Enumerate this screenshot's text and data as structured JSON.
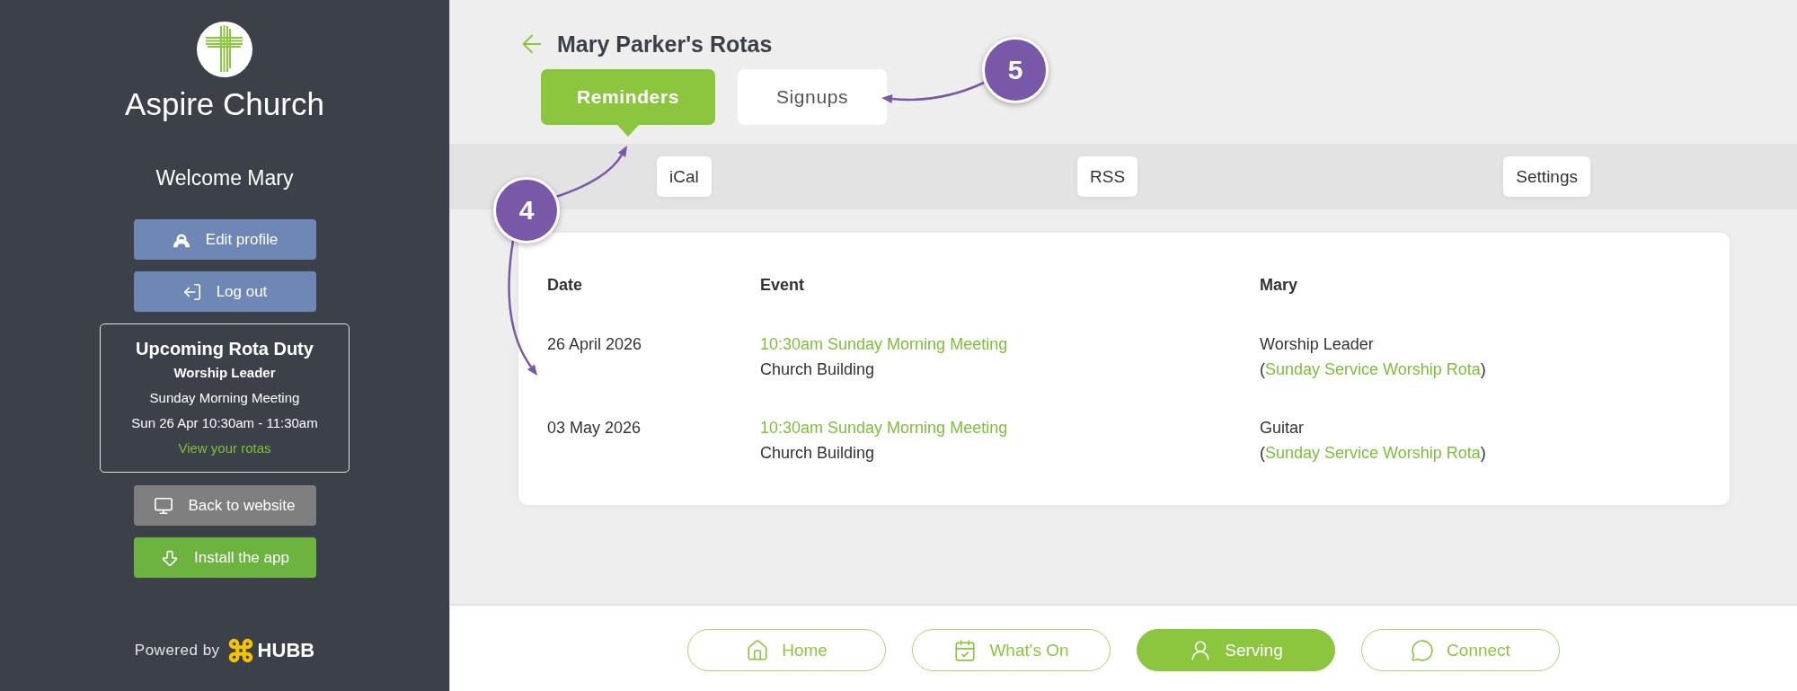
{
  "sidebar": {
    "church_name": "Aspire Church",
    "welcome": "Welcome Mary",
    "account_buttons": [
      {
        "label": "Edit profile"
      },
      {
        "label": "Log out"
      }
    ],
    "upcoming": {
      "title": "Upcoming Rota Duty",
      "role": "Worship Leader",
      "event": "Sunday Morning Meeting",
      "time": "Sun 26 Apr 10:30am - 11:30am",
      "link": "View your rotas"
    },
    "actions": [
      {
        "label": "Back to website",
        "kind": "neutral"
      },
      {
        "label": "Install the app",
        "kind": "highlight"
      }
    ],
    "powered_by": {
      "text": "Powered by",
      "brand": "HUBB"
    }
  },
  "header": {
    "title": "Mary Parker's Rotas"
  },
  "tabs": [
    {
      "label": "Reminders",
      "selected": true
    },
    {
      "label": "Signups",
      "selected": false
    }
  ],
  "toolbar": [
    "iCal",
    "RSS",
    "Settings"
  ],
  "table": {
    "columns": [
      "Date",
      "Event",
      "Mary"
    ],
    "rows": [
      {
        "date": "26 April 2026",
        "event": "10:30am Sunday Morning Meeting",
        "location": "Church Building",
        "role": "Worship Leader",
        "rota": {
          "open": "(",
          "link": "Sunday Service Worship Rota",
          "close": ")"
        }
      },
      {
        "date": "03 May 2026",
        "event": "10:30am Sunday Morning Meeting",
        "location": "Church Building",
        "role": "Guitar",
        "rota": {
          "open": "(",
          "link": "Sunday Service Worship Rota",
          "close": ")"
        }
      }
    ]
  },
  "bottom_nav": [
    {
      "label": "Home",
      "selected": false
    },
    {
      "label": "What's On",
      "selected": false
    },
    {
      "label": "Serving",
      "selected": true
    },
    {
      "label": "Connect",
      "selected": false
    }
  ],
  "annotations": [
    {
      "label": "4"
    },
    {
      "label": "5"
    }
  ]
}
